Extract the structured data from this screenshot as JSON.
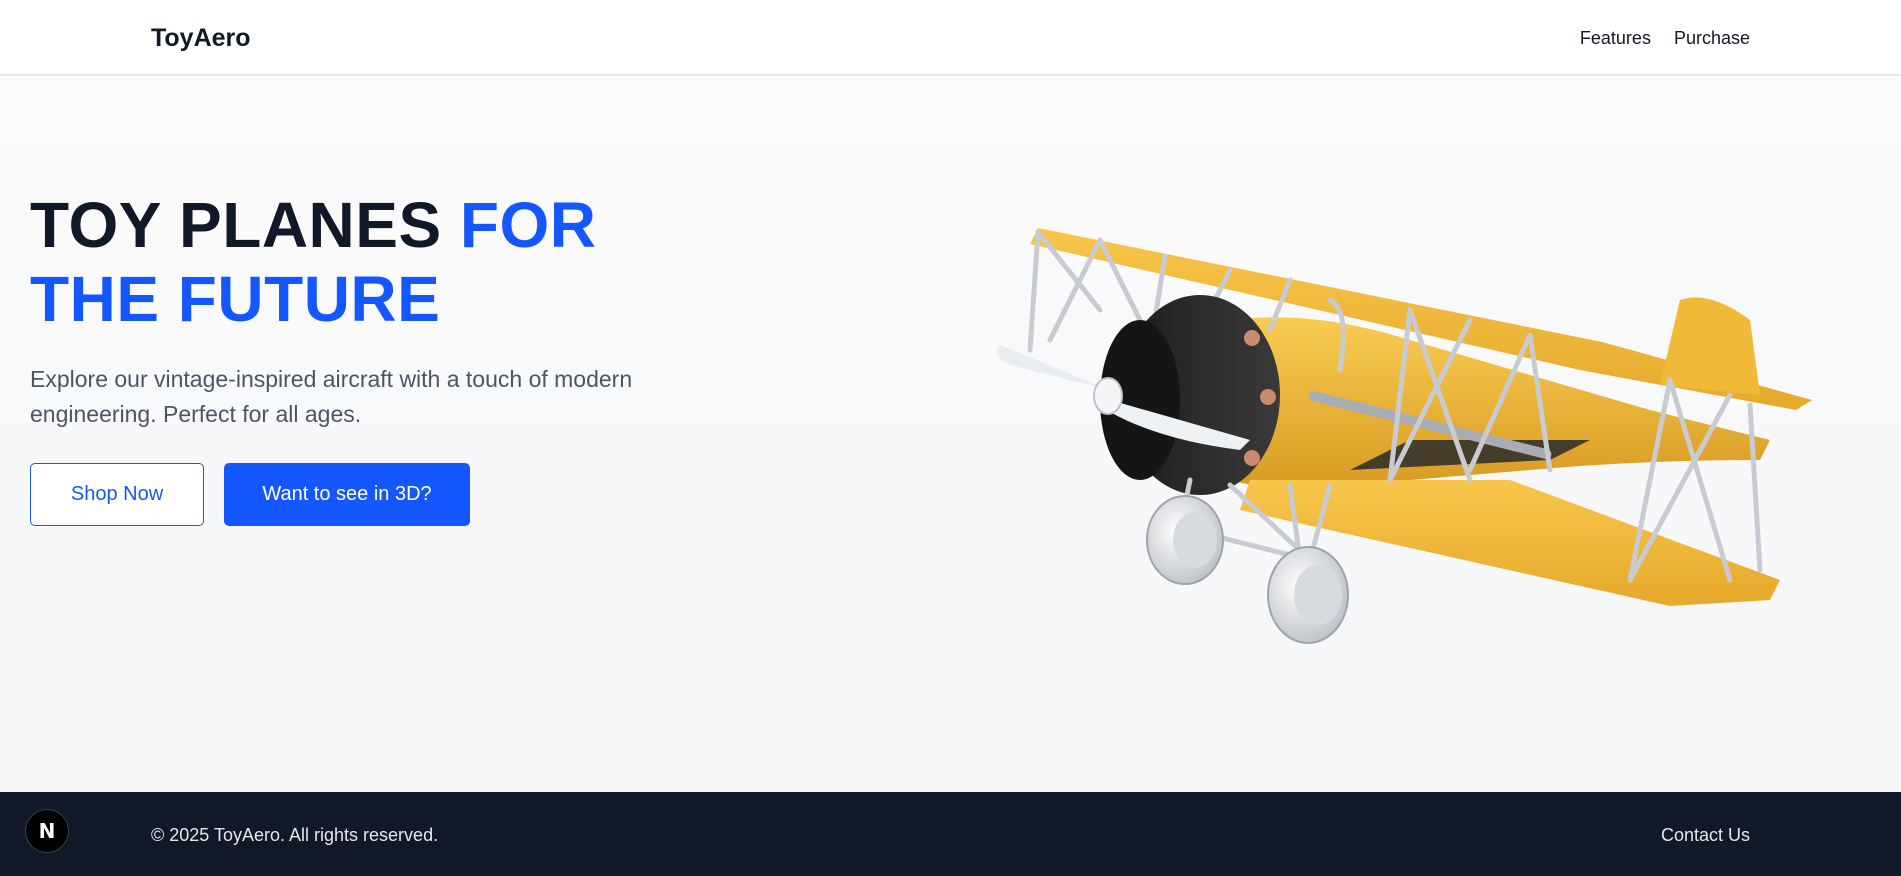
{
  "header": {
    "brand": "ToyAero",
    "nav": [
      {
        "label": "Features"
      },
      {
        "label": "Purchase"
      }
    ]
  },
  "hero": {
    "title_dark": "TOY PLANES ",
    "title_blue": "FOR THE FUTURE",
    "subtitle": "Explore our vintage-inspired aircraft with a touch of modern engineering. Perfect for all ages.",
    "shop_button": "Shop Now",
    "view3d_button": "Want to see in 3D?",
    "plane_icon": "biplane-3d-model",
    "colors": {
      "accent": "#1557ff",
      "plane_body": "#f2b638"
    }
  },
  "footer": {
    "copyright": "© 2025 ToyAero. All rights reserved.",
    "contact": "Contact Us",
    "dev_badge": "N"
  }
}
